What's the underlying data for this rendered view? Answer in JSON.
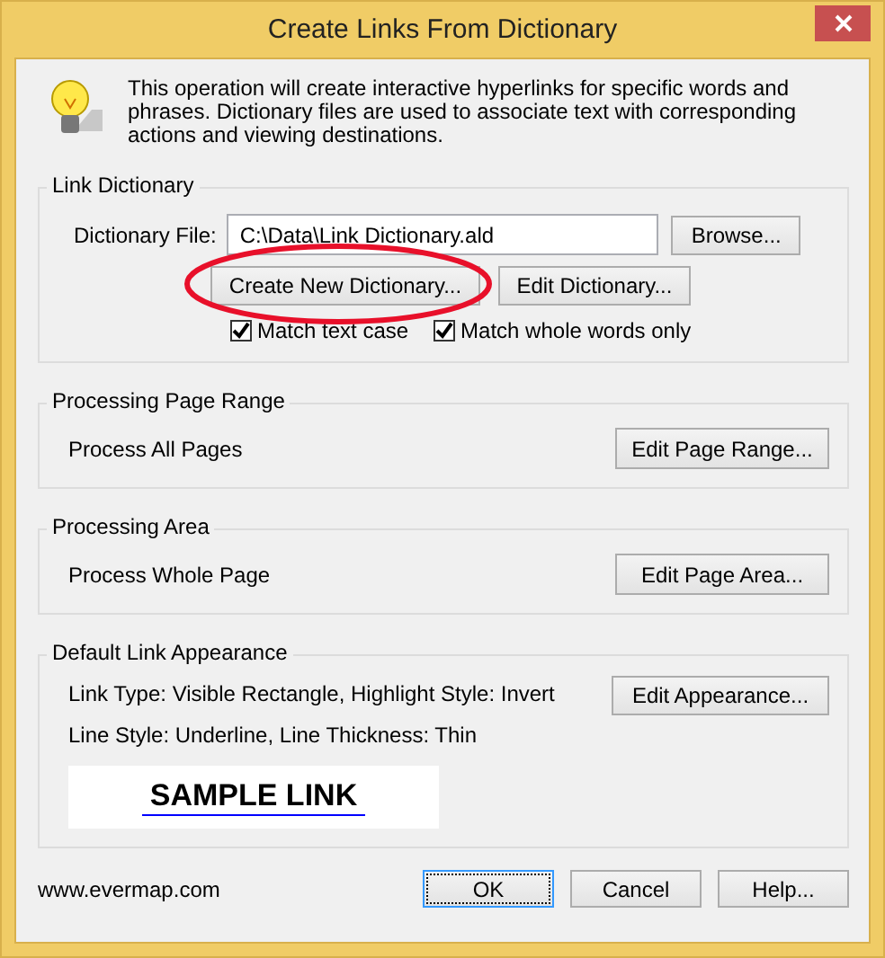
{
  "window": {
    "title": "Create Links From Dictionary"
  },
  "intro": "This operation will create interactive hyperlinks for specific words and phrases. Dictionary files are used to associate text with corresponding actions and viewing destinations.",
  "link_dictionary": {
    "title": "Link Dictionary",
    "file_label": "Dictionary File:",
    "file_value": "C:\\Data\\Link Dictionary.ald",
    "browse": "Browse...",
    "create": "Create New Dictionary...",
    "edit": "Edit Dictionary...",
    "options": [
      {
        "label": "Match text case",
        "checked": true
      },
      {
        "label": "Match whole words only",
        "checked": true
      }
    ]
  },
  "page_range": {
    "title": "Processing Page Range",
    "text": "Process All Pages",
    "button": "Edit Page Range..."
  },
  "area": {
    "title": "Processing Area",
    "text": "Process Whole Page",
    "button": "Edit Page Area..."
  },
  "appearance": {
    "title": "Default Link Appearance",
    "lines": [
      "Link Type: Visible Rectangle, Highlight Style: Invert",
      "Line Style: Underline, Line Thickness: Thin"
    ],
    "button": "Edit Appearance...",
    "sample": "SAMPLE LINK"
  },
  "footer": {
    "website": "www.evermap.com",
    "buttons": [
      {
        "label": "OK",
        "default": true
      },
      {
        "label": "Cancel",
        "default": false
      },
      {
        "label": "Help...",
        "default": false
      }
    ]
  }
}
